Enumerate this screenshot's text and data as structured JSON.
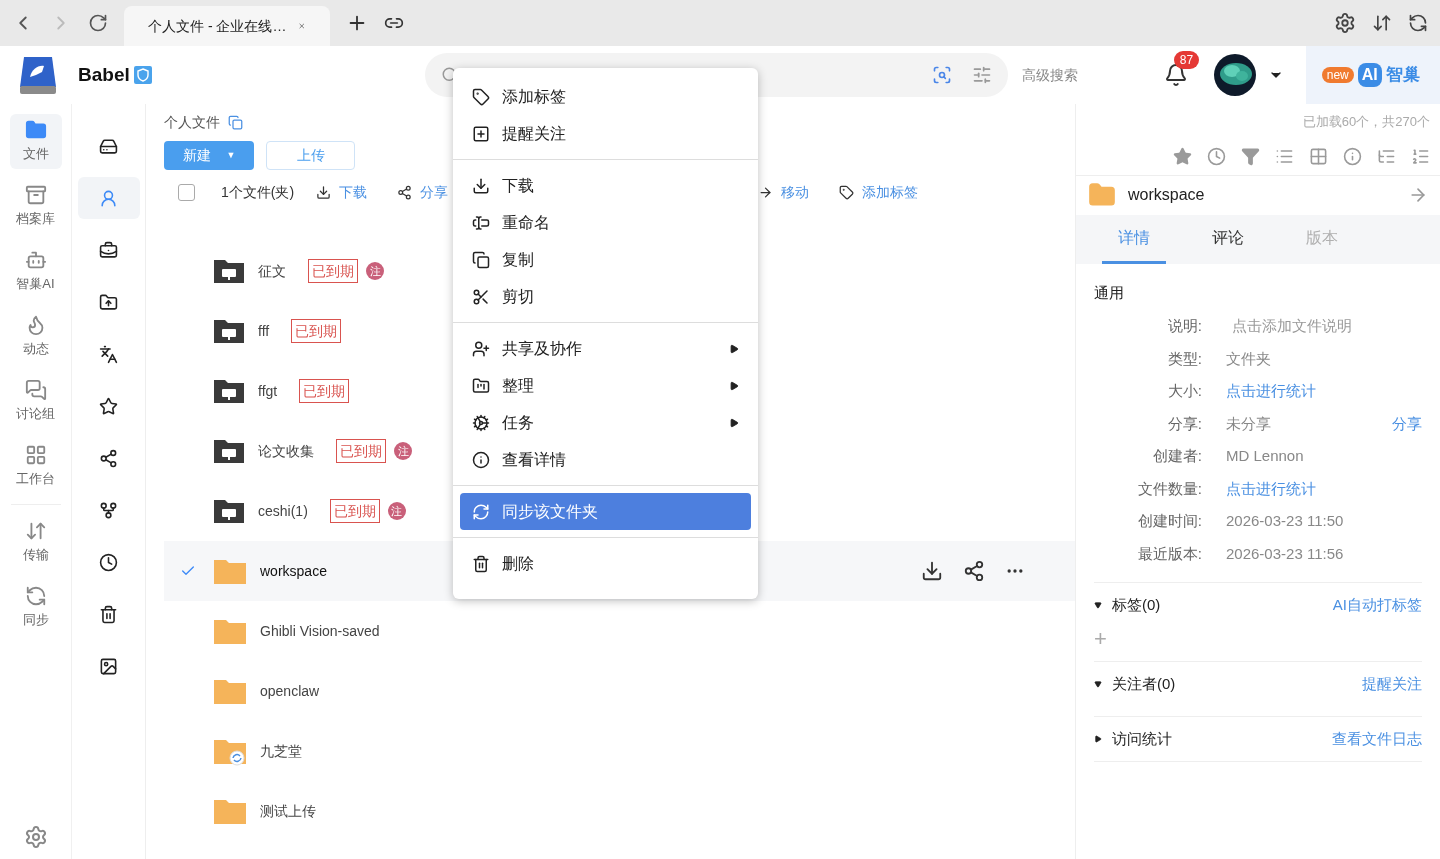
{
  "browser": {
    "tab": {
      "title": "个人文件 - 企业在线…"
    }
  },
  "header": {
    "brand": "Babel",
    "advanced_search": "高级搜索",
    "notification_count": "87",
    "ai": {
      "badge": "new",
      "logo": "AI",
      "label": "智巢"
    }
  },
  "nav": [
    {
      "label": "文件",
      "selected": true
    },
    {
      "label": "档案库",
      "selected": false
    },
    {
      "label": "智巢AI",
      "selected": false
    },
    {
      "label": "动态",
      "selected": false
    },
    {
      "label": "讨论组",
      "selected": false
    },
    {
      "label": "工作台",
      "selected": false
    },
    {
      "label": "传输",
      "selected": false
    },
    {
      "label": "同步",
      "selected": false
    }
  ],
  "sub_nav": [
    {
      "kind": "drive",
      "selected": false
    },
    {
      "kind": "personal",
      "selected": true
    },
    {
      "kind": "toolbox",
      "selected": false
    },
    {
      "kind": "shared_folder",
      "selected": false
    },
    {
      "kind": "translate",
      "selected": false
    },
    {
      "kind": "star",
      "selected": false
    },
    {
      "kind": "share",
      "selected": false
    },
    {
      "kind": "link",
      "selected": false
    },
    {
      "kind": "recent",
      "selected": false
    },
    {
      "kind": "trash",
      "selected": false
    },
    {
      "kind": "gallery",
      "selected": false
    }
  ],
  "breadcrumb": "个人文件",
  "buttons": {
    "new": "新建",
    "new_caret": "▼",
    "upload": "上传"
  },
  "loaded_count": "已加载60个，共270个",
  "selection_bar": {
    "checked": false,
    "count": "1个文件(夹)",
    "actions": [
      "下载",
      "分享",
      "移动",
      "添加标签"
    ]
  },
  "files": [
    {
      "name": "征文",
      "kind": "shared",
      "tag": "已到期",
      "note": "注",
      "selected": false
    },
    {
      "name": "fff",
      "kind": "shared",
      "tag": "已到期",
      "selected": false
    },
    {
      "name": "ffgt",
      "kind": "shared",
      "tag": "已到期",
      "selected": false
    },
    {
      "name": "论文收集",
      "kind": "shared",
      "tag": "已到期",
      "note": "注",
      "selected": false
    },
    {
      "name": "ceshi(1)",
      "kind": "shared",
      "tag": "已到期",
      "note": "注",
      "selected": false
    },
    {
      "name": "workspace",
      "kind": "folder",
      "selected": true
    },
    {
      "name": "Ghibli Vision-saved",
      "kind": "folder",
      "selected": false
    },
    {
      "name": "openclaw",
      "kind": "folder",
      "selected": false
    },
    {
      "name": "九芝堂",
      "kind": "synced",
      "selected": false
    },
    {
      "name": "测试上传",
      "kind": "folder",
      "selected": false
    }
  ],
  "context_menu": [
    [
      {
        "label": "添加标签",
        "submenu": false,
        "highlighted": false
      },
      {
        "label": "提醒关注",
        "submenu": false,
        "highlighted": false
      }
    ],
    [
      {
        "label": "下载",
        "submenu": false,
        "highlighted": false
      },
      {
        "label": "重命名",
        "submenu": false,
        "highlighted": false
      },
      {
        "label": "复制",
        "submenu": false,
        "highlighted": false
      },
      {
        "label": "剪切",
        "submenu": false,
        "highlighted": false
      }
    ],
    [
      {
        "label": "共享及协作",
        "submenu": true,
        "highlighted": false
      },
      {
        "label": "整理",
        "submenu": true,
        "highlighted": false
      },
      {
        "label": "任务",
        "submenu": true,
        "highlighted": false
      },
      {
        "label": "查看详情",
        "submenu": false,
        "highlighted": false
      }
    ],
    [
      {
        "label": "同步该文件夹",
        "submenu": false,
        "highlighted": true
      }
    ],
    [
      {
        "label": "删除",
        "submenu": false,
        "highlighted": false
      }
    ]
  ],
  "details": {
    "title": "workspace",
    "tabs": [
      {
        "label": "详情",
        "selected": true,
        "disabled": false
      },
      {
        "label": "评论",
        "selected": false,
        "disabled": false
      },
      {
        "label": "版本",
        "selected": false,
        "disabled": true
      }
    ],
    "section": "通用",
    "fields": [
      {
        "label": "说明:",
        "value": "点击添加文件说明",
        "kind": "placeholder"
      },
      {
        "label": "类型:",
        "value": "文件夹",
        "kind": "text"
      },
      {
        "label": "大小:",
        "value": "点击进行统计",
        "kind": "link"
      },
      {
        "label": "分享:",
        "value": "未分享",
        "kind": "text",
        "action": "分享"
      },
      {
        "label": "创建者:",
        "value": "MD Lennon",
        "kind": "text"
      },
      {
        "label": "文件数量:",
        "value": "点击进行统计",
        "kind": "link"
      },
      {
        "label": "创建时间:",
        "value": "2026-03-23 11:50",
        "kind": "text"
      },
      {
        "label": "最近版本:",
        "value": "2026-03-23 11:56",
        "kind": "text"
      }
    ],
    "groups": [
      {
        "title": "标签(0)",
        "expanded": true,
        "action": "AI自动打标签",
        "add": "+"
      },
      {
        "title": "关注者(0)",
        "expanded": true,
        "action": "提醒关注"
      },
      {
        "title": "访问统计",
        "expanded": false,
        "action": "查看文件日志"
      }
    ]
  }
}
